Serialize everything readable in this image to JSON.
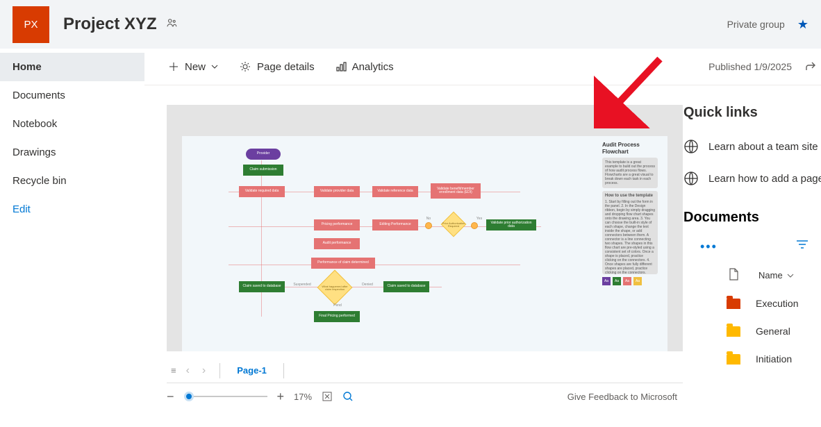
{
  "header": {
    "logo_text": "PX",
    "title": "Project XYZ",
    "privacy": "Private group"
  },
  "leftnav": {
    "items": [
      "Home",
      "Documents",
      "Notebook",
      "Drawings",
      "Recycle bin"
    ],
    "edit": "Edit",
    "selected": 0
  },
  "cmdbar": {
    "new": "New",
    "page_details": "Page details",
    "analytics": "Analytics",
    "published": "Published 1/9/2025"
  },
  "flowchart": {
    "provider": "Provider",
    "claim_sub": "Claim submission",
    "v1": "Validate required data",
    "v2": "Validate provider data",
    "v3": "Validate reference data",
    "v4": "Validate benefit/member enrollment data (EDI)",
    "v5": "Pricing performance",
    "v6": "Editing Performance",
    "v7": "Validate prior authorization data",
    "v8": "Audit performance",
    "v9": "Performance of claim determined",
    "v10": "Claim saved to database",
    "v11": "Claim saved to database",
    "v12": "Final Pricing performed",
    "diamond1": "Prior Authorization Required",
    "diamond2": "What happened after claim inspection",
    "l_yes": "Yes",
    "l_no": "No",
    "l_pend": "Pend",
    "l_susp": "Suspended",
    "l_denied": "Denied"
  },
  "audit": {
    "title": "Audit Process Flowchart",
    "desc": "This template is a great example to build out the process of how audit process flows. Flowcharts are a great visual to break down each task in each process.",
    "howto_title": "How to use the template",
    "howto_body": "1. Start by filling out the form in the panel.\n2. In the Design ribbon, begin by simply dragging and dropping flow chart shapes onto the drawing area.\n3. You can choose the built-in style of each shape, change the text inside the shape, or add connectors between them. A connector is a line connecting two shapes. The shapes in this flow chart are pre-styled using a consistent set of colors. Once a shape is placed, practice clicking on the connectors.\n4. Once shapes are fully different shapes are placed, practice clicking on the connectors."
  },
  "pager": {
    "page": "Page-1"
  },
  "zoom": {
    "percent": "17%",
    "feedback": "Give Feedback to Microsoft"
  },
  "rail": {
    "ql_title": "Quick links",
    "ql": [
      "Learn about a team site",
      "Learn how to add a page"
    ],
    "docs_title": "Documents",
    "name_col": "Name",
    "folders": [
      {
        "name": "Execution",
        "color": "red"
      },
      {
        "name": "General",
        "color": "yellow"
      },
      {
        "name": "Initiation",
        "color": "yellow"
      }
    ]
  }
}
